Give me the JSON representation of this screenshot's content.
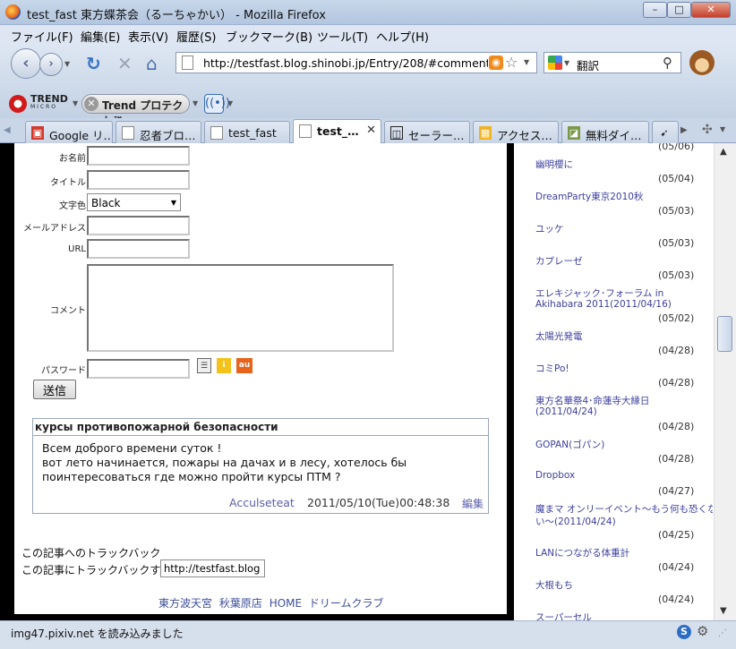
{
  "window": {
    "title": "test_fast 東方蝶茶会（るーちゃかい） - Mozilla Firefox",
    "min": "–",
    "max": "□",
    "close": "✕"
  },
  "menu": [
    "ファイル(F)",
    "編集(E)",
    "表示(V)",
    "履歴(S)",
    "ブックマーク(B)",
    "ツール(T)",
    "ヘルプ(H)"
  ],
  "nav": {
    "url": "http://testfast.blog.shinobi.jp/Entry/208/#comment1",
    "search_engine": "Google",
    "search_text": "翻訳"
  },
  "toolbar2": {
    "trend_brand": "TREND",
    "trend_sub": "MICRO",
    "protect_label": "Trend プロテクト™"
  },
  "tabs": [
    {
      "label": "Google リ…",
      "icon": "google-icon"
    },
    {
      "label": "忍者ブロ…",
      "icon": "page-icon"
    },
    {
      "label": "test_fast",
      "icon": "page-icon"
    },
    {
      "label": "test_…",
      "icon": "page-icon",
      "active": true
    },
    {
      "label": "セーラー…",
      "icon": "site-icon"
    },
    {
      "label": "アクセス…",
      "icon": "site-icon"
    },
    {
      "label": "無料ダイ…",
      "icon": "site-icon"
    }
  ],
  "form": {
    "name_label": "お名前",
    "title_label": "タイトル",
    "color_label": "文字色",
    "color_value": "Black",
    "email_label": "メールアドレス",
    "url_label": "URL",
    "comment_label": "コメント",
    "password_label": "パスワード",
    "mobile_au": "au",
    "submit_label": "送信"
  },
  "comment": {
    "title": "курсы противопожарной безопасности",
    "lines": [
      "Всем доброго времени суток !",
      "вот лето начинается, пожары на дачах и в лесу, хотелось бы",
      "поинтересоваться где можно пройти курсы ПТМ ?"
    ],
    "author": "Acculseteat",
    "date": "2011/05/10(Tue)00:48:38",
    "edit": "編集"
  },
  "trackback": {
    "label": "この記事へのトラックバック",
    "label2": "この記事にトラックバックする:",
    "url": "http://testfast.blog"
  },
  "footer": [
    "東方波天宮",
    "秋葉原店",
    "HOME",
    "ドリームクラブ"
  ],
  "sidebar": [
    {
      "date": "(05/06)",
      "title": "幽明櫻に"
    },
    {
      "date": "(05/04)",
      "title": "DreamParty東京2010秋"
    },
    {
      "date": "(05/03)",
      "title": "ユッケ"
    },
    {
      "date": "(05/03)",
      "title": "カプレーゼ"
    },
    {
      "date": "(05/03)",
      "title": "エレキジャック･フォーラム in"
    },
    {
      "date": "",
      "title": "Akihabara 2011(2011/04/16)"
    },
    {
      "date": "(05/02)",
      "title": "太陽光発電"
    },
    {
      "date": "(04/28)",
      "title": "コミPo!"
    },
    {
      "date": "(04/28)",
      "title": "東方名華祭4･命蓮寺大縁日"
    },
    {
      "date": "",
      "title": "(2011/04/24)"
    },
    {
      "date": "(04/28)",
      "title": "GOPAN(ゴパン)"
    },
    {
      "date": "(04/28)",
      "title": "Dropbox"
    },
    {
      "date": "(04/27)",
      "title": "魔まマ オンリーイベント～もう何も恐くな"
    },
    {
      "date": "",
      "title": "い～(2011/04/24)"
    },
    {
      "date": "(04/25)",
      "title": "LANにつながる体重計"
    },
    {
      "date": "(04/24)",
      "title": "大根もち"
    },
    {
      "date": "(04/24)",
      "title": "スーパーセル"
    }
  ],
  "status": {
    "text": "img47.pixiv.net を読み込みました"
  }
}
